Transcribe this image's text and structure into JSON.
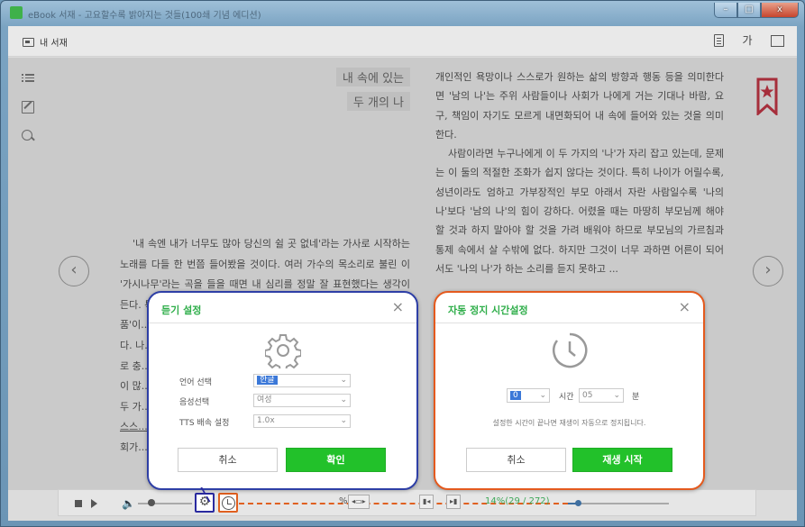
{
  "window": {
    "title": "eBook 서재 - 고요할수록 밝아지는 것들(100쇄 기념 에디션)",
    "buttons": {
      "minimize": "–",
      "maximize": "□",
      "close": "x"
    }
  },
  "toolbar": {
    "library_label": "내 서재",
    "font_label": "가"
  },
  "book": {
    "left_heading": [
      "내 속에 있는",
      "두 개의 나"
    ],
    "left_paragraphs": [
      "'내 속엔 내가 너무도 많아 당신의 쉴 곳 없네'라는 가사로 시작하는 노래를 다들 한 번쯤 들어봤을 것이다. 여러 가수의 목소리로 불린 이 '가시나무'라는 곡을 들을 때면 내 심리를 정말 잘 표현했다는 생각이 든다. 특히 내 속에 있는 여러 개의 '나'들...",
      "품'이...",
      "다. 나...",
      "로 충...",
      "이 많...",
      "두 가...",
      "스스...",
      "회가..."
    ],
    "right_paragraphs": [
      "개인적인 욕망이나 스스로가 원하는 삶의 방향과 행동 등을 의미한다면 '남의 나'는 주위 사람들이나 사회가 나에게 거는 기대나 바람, 요구, 책임이 자기도 모르게 내면화되어 내 속에 들어와 있는 것을 의미한다.",
      "사람이라면 누구나에게 이 두 가지의 '나'가 자리 잡고 있는데, 문제는 이 둘의 적절한 조화가 쉽지 않다는 것이다. 특히 나이가 어릴수록, 성년이라도 엄하고 가부장적인 부모 아래서 자란 사람일수록 '나의 나'보다 '남의 나'의 힘이 강하다. 어렸을 때는 마땅히 부모님께 해야 할 것과 하지 말아야 할 것을 가려 배워야 하므로 부모님의 가르침과 통제 속에서 살 수밖에 없다. 하지만 그것이 너무 과하면 어른이 되어서도 '나의 나'가 하는 소리를 듣지 못하고 ..."
    ]
  },
  "bottom": {
    "percent": "%",
    "page_count": "14%(29 / 272)",
    "progress_fraction": 0.1,
    "volume_fraction": 0.25
  },
  "listen_dialog": {
    "title": "듣기 설정",
    "close": "×",
    "rows": [
      {
        "label": "언어 선택",
        "value": "한글",
        "selected": true
      },
      {
        "label": "음성선택",
        "value": "여성",
        "selected": false
      },
      {
        "label": "TTS 배속 설정",
        "value": "1.0x",
        "selected": false
      }
    ],
    "cancel": "취소",
    "ok": "확인"
  },
  "timer_dialog": {
    "title": "자동 정지 시간설정",
    "close": "×",
    "hour_value": "0",
    "hour_label": "시간",
    "minute_value": "05",
    "minute_label": "분",
    "note": "설정한 시간이 끝나면 재생이 자동으로 정지됩니다.",
    "cancel": "취소",
    "start": "재생 시작"
  },
  "colors": {
    "accent_green": "#2fae4a",
    "listen_border": "#2e3fa6",
    "timer_border": "#e45a1e",
    "bookmark": "#b01e2e"
  }
}
